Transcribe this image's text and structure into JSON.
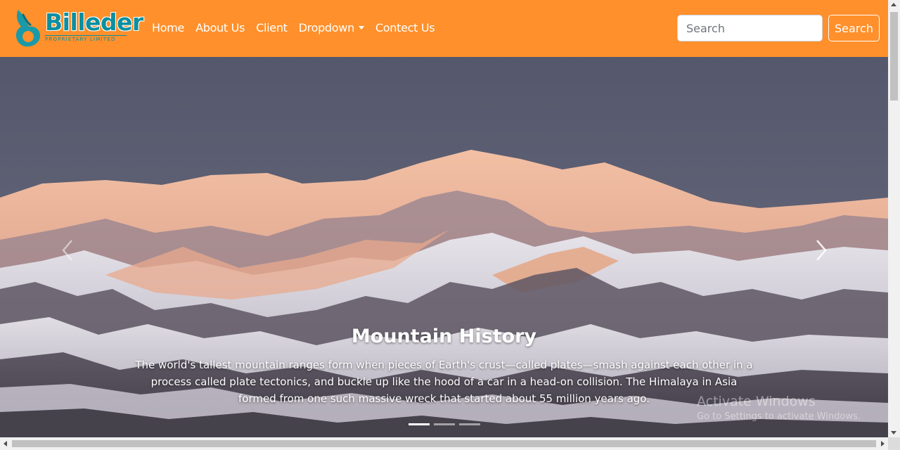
{
  "brand": {
    "name": "Billeder",
    "subtitle": "PROPRIETARY LIMITED",
    "colors": {
      "primary": "#0c8fa0",
      "accent": "#ff902b"
    }
  },
  "navbar": {
    "background": "#ff902b",
    "links": [
      {
        "label": "Home"
      },
      {
        "label": "About Us"
      },
      {
        "label": "Client"
      },
      {
        "label": "Dropdown",
        "has_caret": true
      },
      {
        "label": "Contect Us"
      }
    ]
  },
  "search": {
    "placeholder": "Search",
    "value": "",
    "button_label": "Search"
  },
  "carousel": {
    "active_index": 0,
    "slide_count": 3,
    "caption": {
      "title": "Mountain History",
      "text": "The world's tallest mountain ranges form when pieces of Earth's crust—called plates—smash against each other in a process called plate tectonics, and buckle up like the hood of a car in a head-on collision. The Himalaya in Asia formed from one such massive wreck that started about 55 million years ago."
    },
    "prev_icon": "chevron-left-icon",
    "next_icon": "chevron-right-icon"
  },
  "watermark": {
    "line1": "Activate Windows",
    "line2": "Go to Settings to activate Windows."
  }
}
